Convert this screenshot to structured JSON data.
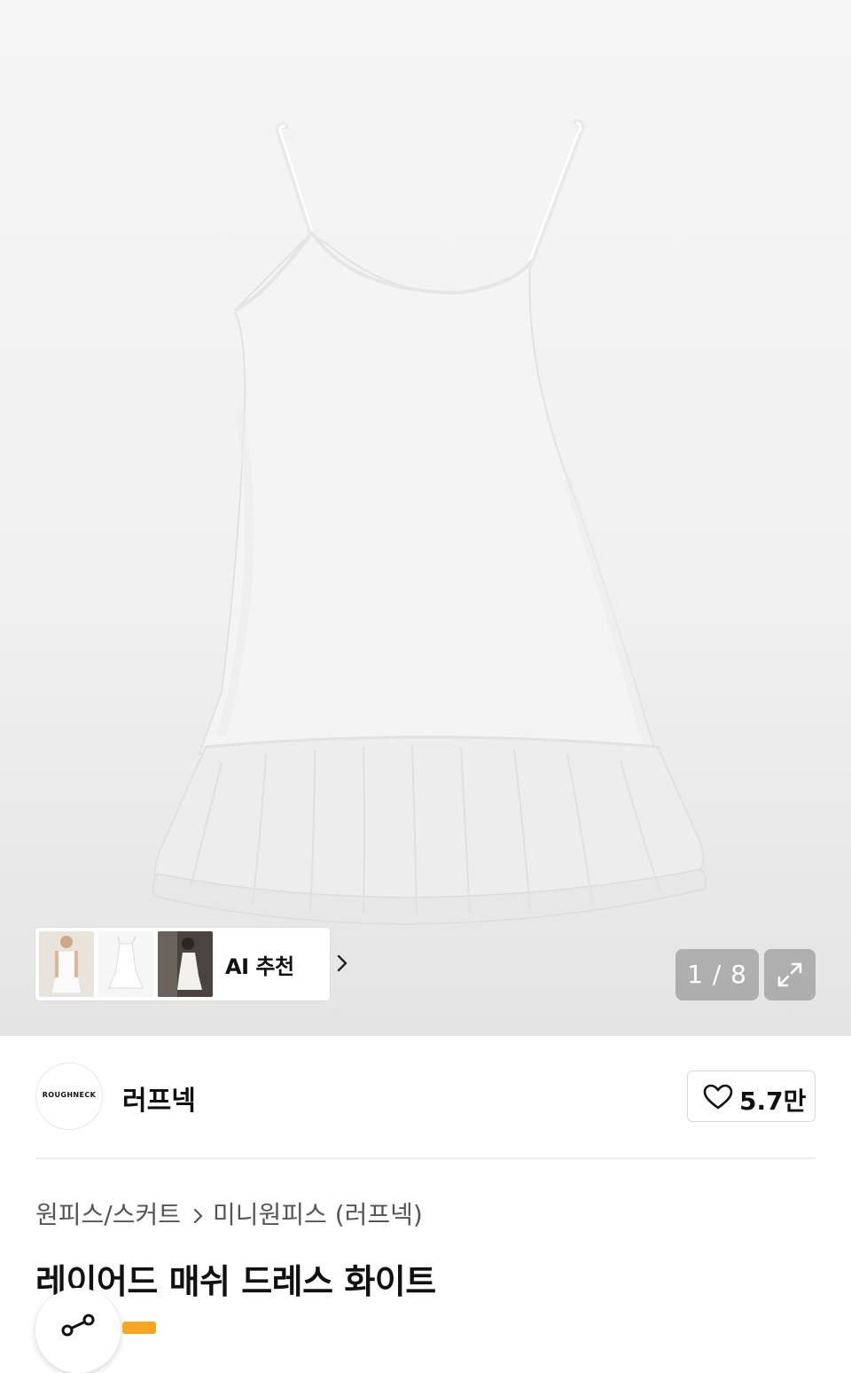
{
  "gallery": {
    "current": "1",
    "total": "8",
    "counter_text": "1 / 8",
    "thumbnails": [
      "model-front-thumb",
      "product-flat-thumb",
      "model-mirror-thumb"
    ],
    "ai_label": "AI 추천"
  },
  "brand": {
    "logo_text": "ROUGHNECK",
    "name": "러프넥",
    "like_count": "5.7만"
  },
  "breadcrumb": {
    "category": "원피스/스커트",
    "subcategory": "미니원피스 (러프넥)"
  },
  "product": {
    "title": "레이어드 매쉬 드레스 화이트"
  },
  "icons": {
    "chevron": "chevron-right-icon",
    "expand": "expand-icon",
    "heart": "heart-icon",
    "share": "share-icon"
  },
  "colors": {
    "accent": "#f5a623",
    "counter_bg": "#8c8c8c"
  }
}
